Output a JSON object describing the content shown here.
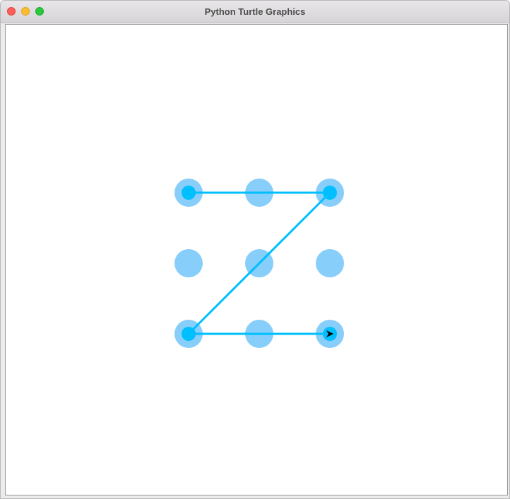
{
  "window": {
    "title": "Python Turtle Graphics"
  },
  "colors": {
    "dot": "#87cefa",
    "selected_dot": "#00bfff",
    "line": "#00bfff",
    "turtle": "#000000",
    "canvas_bg": "#ffffff"
  },
  "grid": {
    "rows": 3,
    "cols": 3,
    "pattern_path": [
      1,
      3,
      7,
      9
    ],
    "selected_nodes": [
      1,
      3,
      7,
      9
    ]
  },
  "turtle": {
    "shape": "classic-arrow",
    "heading": "east"
  }
}
